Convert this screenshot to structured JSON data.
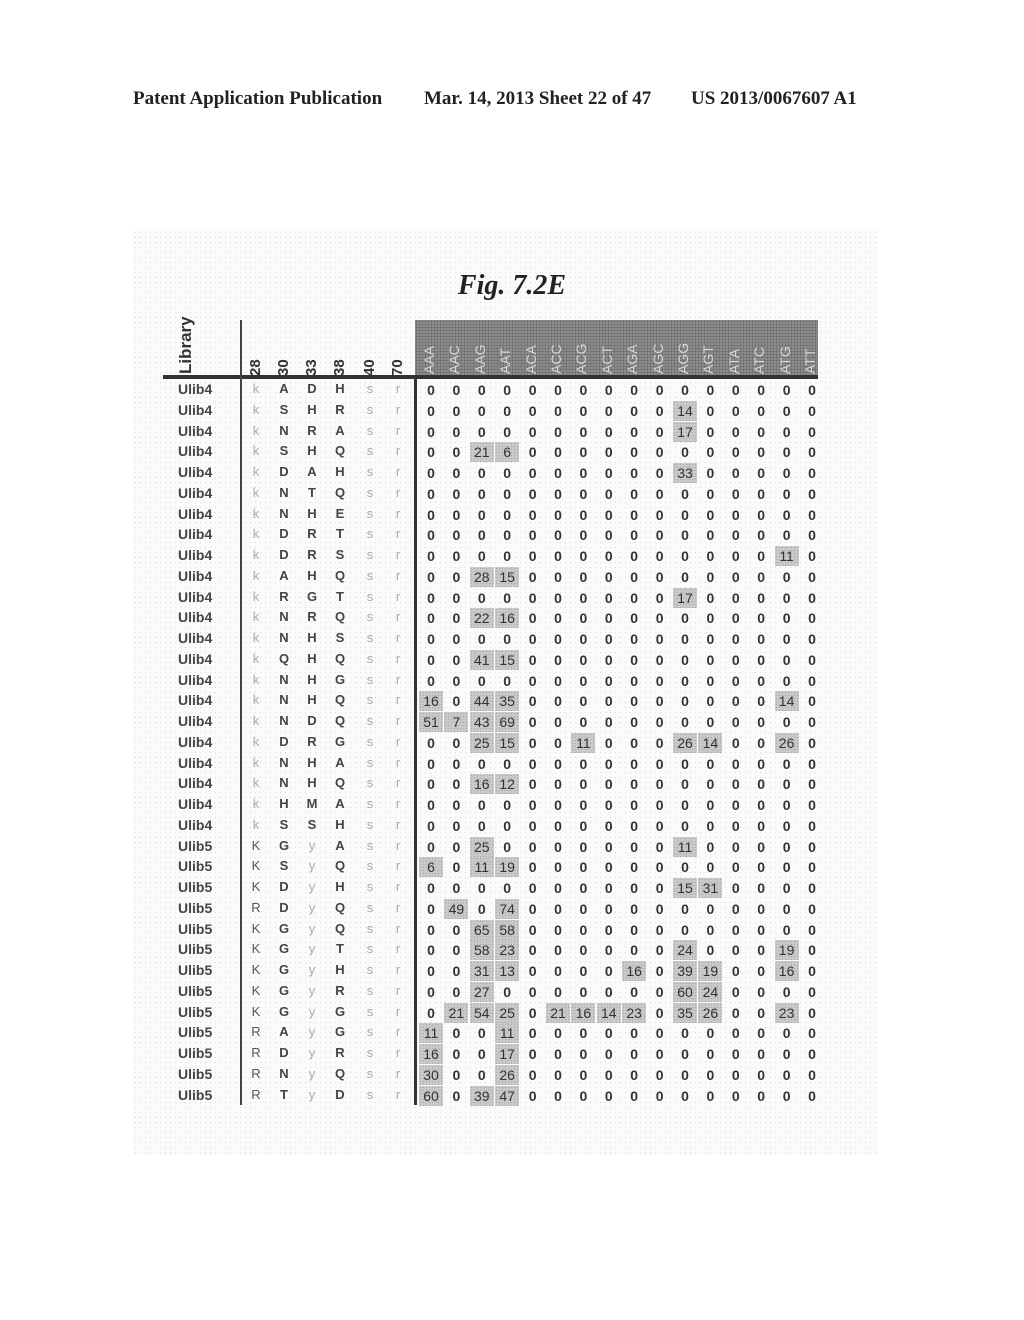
{
  "header": {
    "publication": "Patent Application Publication",
    "date_sheet": "Mar. 14, 2013  Sheet 22 of 47",
    "patent_number": "US 2013/0067607 A1"
  },
  "figure": {
    "title": "Fig. 7.2E",
    "library_header": "Library",
    "position_headers": [
      "28",
      "30",
      "33",
      "38",
      "40",
      "70"
    ],
    "codon_headers": [
      "AAA",
      "AAC",
      "AAG",
      "AAT",
      "ACA",
      "ACC",
      "ACG",
      "ACT",
      "AGA",
      "AGC",
      "AGG",
      "AGT",
      "ATA",
      "ATC",
      "ATG",
      "ATT"
    ],
    "highlight_color": "#c9c9c9",
    "header_band_color": "#8c8c8c",
    "rows": [
      {
        "library": "Ulib4",
        "residues": [
          "k",
          "A",
          "D",
          "H",
          "s",
          "r"
        ],
        "counts": [
          0,
          0,
          0,
          0,
          0,
          0,
          0,
          0,
          0,
          0,
          0,
          0,
          0,
          0,
          0,
          0
        ]
      },
      {
        "library": "Ulib4",
        "residues": [
          "k",
          "S",
          "H",
          "R",
          "s",
          "r"
        ],
        "counts": [
          0,
          0,
          0,
          0,
          0,
          0,
          0,
          0,
          0,
          0,
          14,
          0,
          0,
          0,
          0,
          0
        ]
      },
      {
        "library": "Ulib4",
        "residues": [
          "k",
          "N",
          "R",
          "A",
          "s",
          "r"
        ],
        "counts": [
          0,
          0,
          0,
          0,
          0,
          0,
          0,
          0,
          0,
          0,
          17,
          0,
          0,
          0,
          0,
          0
        ]
      },
      {
        "library": "Ulib4",
        "residues": [
          "k",
          "S",
          "H",
          "Q",
          "s",
          "r"
        ],
        "counts": [
          0,
          0,
          21,
          6,
          0,
          0,
          0,
          0,
          0,
          0,
          0,
          0,
          0,
          0,
          0,
          0
        ]
      },
      {
        "library": "Ulib4",
        "residues": [
          "k",
          "D",
          "A",
          "H",
          "s",
          "r"
        ],
        "counts": [
          0,
          0,
          0,
          0,
          0,
          0,
          0,
          0,
          0,
          0,
          33,
          0,
          0,
          0,
          0,
          0
        ]
      },
      {
        "library": "Ulib4",
        "residues": [
          "k",
          "N",
          "T",
          "Q",
          "s",
          "r"
        ],
        "counts": [
          0,
          0,
          0,
          0,
          0,
          0,
          0,
          0,
          0,
          0,
          0,
          0,
          0,
          0,
          0,
          0
        ]
      },
      {
        "library": "Ulib4",
        "residues": [
          "k",
          "N",
          "H",
          "E",
          "s",
          "r"
        ],
        "counts": [
          0,
          0,
          0,
          0,
          0,
          0,
          0,
          0,
          0,
          0,
          0,
          0,
          0,
          0,
          0,
          0
        ]
      },
      {
        "library": "Ulib4",
        "residues": [
          "k",
          "D",
          "R",
          "T",
          "s",
          "r"
        ],
        "counts": [
          0,
          0,
          0,
          0,
          0,
          0,
          0,
          0,
          0,
          0,
          0,
          0,
          0,
          0,
          0,
          0
        ]
      },
      {
        "library": "Ulib4",
        "residues": [
          "k",
          "D",
          "R",
          "S",
          "s",
          "r"
        ],
        "counts": [
          0,
          0,
          0,
          0,
          0,
          0,
          0,
          0,
          0,
          0,
          0,
          0,
          0,
          0,
          11,
          0
        ]
      },
      {
        "library": "Ulib4",
        "residues": [
          "k",
          "A",
          "H",
          "Q",
          "s",
          "r"
        ],
        "counts": [
          0,
          0,
          28,
          15,
          0,
          0,
          0,
          0,
          0,
          0,
          0,
          0,
          0,
          0,
          0,
          0
        ]
      },
      {
        "library": "Ulib4",
        "residues": [
          "k",
          "R",
          "G",
          "T",
          "s",
          "r"
        ],
        "counts": [
          0,
          0,
          0,
          0,
          0,
          0,
          0,
          0,
          0,
          0,
          17,
          0,
          0,
          0,
          0,
          0
        ]
      },
      {
        "library": "Ulib4",
        "residues": [
          "k",
          "N",
          "R",
          "Q",
          "s",
          "r"
        ],
        "counts": [
          0,
          0,
          22,
          16,
          0,
          0,
          0,
          0,
          0,
          0,
          0,
          0,
          0,
          0,
          0,
          0
        ]
      },
      {
        "library": "Ulib4",
        "residues": [
          "k",
          "N",
          "H",
          "S",
          "s",
          "r"
        ],
        "counts": [
          0,
          0,
          0,
          0,
          0,
          0,
          0,
          0,
          0,
          0,
          0,
          0,
          0,
          0,
          0,
          0
        ]
      },
      {
        "library": "Ulib4",
        "residues": [
          "k",
          "Q",
          "H",
          "Q",
          "s",
          "r"
        ],
        "counts": [
          0,
          0,
          41,
          15,
          0,
          0,
          0,
          0,
          0,
          0,
          0,
          0,
          0,
          0,
          0,
          0
        ]
      },
      {
        "library": "Ulib4",
        "residues": [
          "k",
          "N",
          "H",
          "G",
          "s",
          "r"
        ],
        "counts": [
          0,
          0,
          0,
          0,
          0,
          0,
          0,
          0,
          0,
          0,
          0,
          0,
          0,
          0,
          0,
          0
        ]
      },
      {
        "library": "Ulib4",
        "residues": [
          "k",
          "N",
          "H",
          "Q",
          "s",
          "r"
        ],
        "counts": [
          16,
          0,
          44,
          35,
          0,
          0,
          0,
          0,
          0,
          0,
          0,
          0,
          0,
          0,
          14,
          0
        ]
      },
      {
        "library": "Ulib4",
        "residues": [
          "k",
          "N",
          "D",
          "Q",
          "s",
          "r"
        ],
        "counts": [
          51,
          7,
          43,
          69,
          0,
          0,
          0,
          0,
          0,
          0,
          0,
          0,
          0,
          0,
          0,
          0
        ]
      },
      {
        "library": "Ulib4",
        "residues": [
          "k",
          "D",
          "R",
          "G",
          "s",
          "r"
        ],
        "counts": [
          0,
          0,
          25,
          15,
          0,
          0,
          11,
          0,
          0,
          0,
          26,
          14,
          0,
          0,
          26,
          0
        ]
      },
      {
        "library": "Ulib4",
        "residues": [
          "k",
          "N",
          "H",
          "A",
          "s",
          "r"
        ],
        "counts": [
          0,
          0,
          0,
          0,
          0,
          0,
          0,
          0,
          0,
          0,
          0,
          0,
          0,
          0,
          0,
          0
        ]
      },
      {
        "library": "Ulib4",
        "residues": [
          "k",
          "N",
          "H",
          "Q",
          "s",
          "r"
        ],
        "counts": [
          0,
          0,
          16,
          12,
          0,
          0,
          0,
          0,
          0,
          0,
          0,
          0,
          0,
          0,
          0,
          0
        ]
      },
      {
        "library": "Ulib4",
        "residues": [
          "k",
          "H",
          "M",
          "A",
          "s",
          "r"
        ],
        "counts": [
          0,
          0,
          0,
          0,
          0,
          0,
          0,
          0,
          0,
          0,
          0,
          0,
          0,
          0,
          0,
          0
        ]
      },
      {
        "library": "Ulib4",
        "residues": [
          "k",
          "S",
          "S",
          "H",
          "s",
          "r"
        ],
        "counts": [
          0,
          0,
          0,
          0,
          0,
          0,
          0,
          0,
          0,
          0,
          0,
          0,
          0,
          0,
          0,
          0
        ]
      },
      {
        "library": "Ulib5",
        "residues": [
          "K",
          "G",
          "y",
          "A",
          "s",
          "r"
        ],
        "counts": [
          0,
          0,
          25,
          0,
          0,
          0,
          0,
          0,
          0,
          0,
          11,
          0,
          0,
          0,
          0,
          0
        ]
      },
      {
        "library": "Ulib5",
        "residues": [
          "K",
          "S",
          "y",
          "Q",
          "s",
          "r"
        ],
        "counts": [
          6,
          0,
          11,
          19,
          0,
          0,
          0,
          0,
          0,
          0,
          0,
          0,
          0,
          0,
          0,
          0
        ]
      },
      {
        "library": "Ulib5",
        "residues": [
          "K",
          "D",
          "y",
          "H",
          "s",
          "r"
        ],
        "counts": [
          0,
          0,
          0,
          0,
          0,
          0,
          0,
          0,
          0,
          0,
          15,
          31,
          0,
          0,
          0,
          0
        ]
      },
      {
        "library": "Ulib5",
        "residues": [
          "R",
          "D",
          "y",
          "Q",
          "s",
          "r"
        ],
        "counts": [
          0,
          49,
          0,
          74,
          0,
          0,
          0,
          0,
          0,
          0,
          0,
          0,
          0,
          0,
          0,
          0
        ]
      },
      {
        "library": "Ulib5",
        "residues": [
          "K",
          "G",
          "y",
          "Q",
          "s",
          "r"
        ],
        "counts": [
          0,
          0,
          65,
          58,
          0,
          0,
          0,
          0,
          0,
          0,
          0,
          0,
          0,
          0,
          0,
          0
        ]
      },
      {
        "library": "Ulib5",
        "residues": [
          "K",
          "G",
          "y",
          "T",
          "s",
          "r"
        ],
        "counts": [
          0,
          0,
          58,
          23,
          0,
          0,
          0,
          0,
          0,
          0,
          24,
          0,
          0,
          0,
          19,
          0
        ]
      },
      {
        "library": "Ulib5",
        "residues": [
          "K",
          "G",
          "y",
          "H",
          "s",
          "r"
        ],
        "counts": [
          0,
          0,
          31,
          13,
          0,
          0,
          0,
          0,
          16,
          0,
          39,
          19,
          0,
          0,
          16,
          0
        ]
      },
      {
        "library": "Ulib5",
        "residues": [
          "K",
          "G",
          "y",
          "R",
          "s",
          "r"
        ],
        "counts": [
          0,
          0,
          27,
          0,
          0,
          0,
          0,
          0,
          0,
          0,
          60,
          24,
          0,
          0,
          0,
          0
        ]
      },
      {
        "library": "Ulib5",
        "residues": [
          "K",
          "G",
          "y",
          "G",
          "s",
          "r"
        ],
        "counts": [
          0,
          21,
          54,
          25,
          0,
          21,
          16,
          14,
          23,
          0,
          35,
          26,
          0,
          0,
          23,
          0
        ]
      },
      {
        "library": "Ulib5",
        "residues": [
          "R",
          "A",
          "y",
          "G",
          "s",
          "r"
        ],
        "counts": [
          11,
          0,
          0,
          11,
          0,
          0,
          0,
          0,
          0,
          0,
          0,
          0,
          0,
          0,
          0,
          0
        ]
      },
      {
        "library": "Ulib5",
        "residues": [
          "R",
          "D",
          "y",
          "R",
          "s",
          "r"
        ],
        "counts": [
          16,
          0,
          0,
          17,
          0,
          0,
          0,
          0,
          0,
          0,
          0,
          0,
          0,
          0,
          0,
          0
        ]
      },
      {
        "library": "Ulib5",
        "residues": [
          "R",
          "N",
          "y",
          "Q",
          "s",
          "r"
        ],
        "counts": [
          30,
          0,
          0,
          26,
          0,
          0,
          0,
          0,
          0,
          0,
          0,
          0,
          0,
          0,
          0,
          0
        ]
      },
      {
        "library": "Ulib5",
        "residues": [
          "R",
          "T",
          "y",
          "D",
          "s",
          "r"
        ],
        "counts": [
          60,
          0,
          39,
          47,
          0,
          0,
          0,
          0,
          0,
          0,
          0,
          0,
          0,
          0,
          0,
          0
        ]
      }
    ]
  }
}
